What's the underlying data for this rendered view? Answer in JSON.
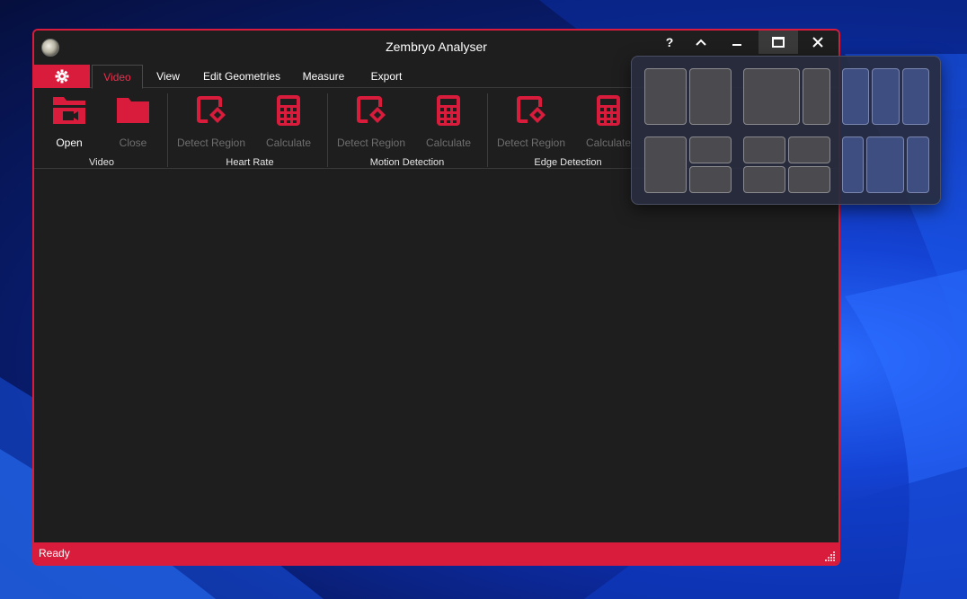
{
  "window": {
    "title": "Zembryo Analyser",
    "controls": {
      "help": "?",
      "collapse": "^"
    }
  },
  "tabs": [
    {
      "label": "Video",
      "selected": true
    },
    {
      "label": "View"
    },
    {
      "label": "Edit Geometries"
    },
    {
      "label": "Measure"
    },
    {
      "label": "Export"
    }
  ],
  "ribbon": {
    "groups": [
      {
        "name": "Video",
        "buttons": [
          {
            "label": "Open",
            "icon": "folder-video-icon",
            "enabled": true
          },
          {
            "label": "Close",
            "icon": "folder-icon",
            "enabled": false
          }
        ]
      },
      {
        "name": "Heart Rate",
        "buttons": [
          {
            "label": "Detect Region",
            "icon": "detect-region-icon",
            "enabled": false
          },
          {
            "label": "Calculate",
            "icon": "calculator-icon",
            "enabled": false
          }
        ]
      },
      {
        "name": "Motion Detection",
        "buttons": [
          {
            "label": "Detect Region",
            "icon": "detect-region-icon",
            "enabled": false
          },
          {
            "label": "Calculate",
            "icon": "calculator-icon",
            "enabled": false
          }
        ]
      },
      {
        "name": "Edge Detection",
        "buttons": [
          {
            "label": "Detect Region",
            "icon": "detect-region-icon",
            "enabled": false
          },
          {
            "label": "Calculate",
            "icon": "calculator-icon",
            "enabled": false
          }
        ]
      }
    ]
  },
  "status": {
    "text": "Ready"
  },
  "colors": {
    "accent": "#d91b3c",
    "background": "#1e1e1e",
    "disabled_text": "#6e6e6e"
  }
}
